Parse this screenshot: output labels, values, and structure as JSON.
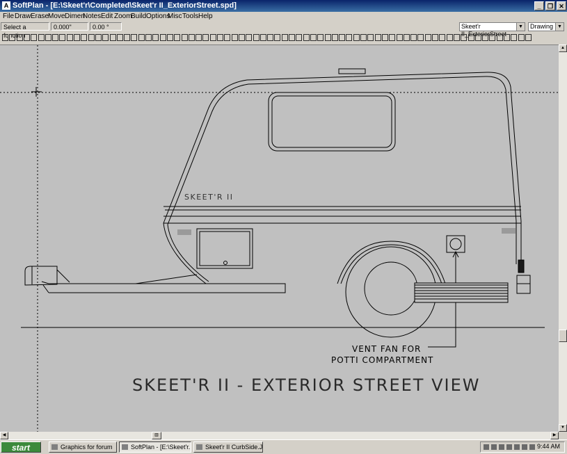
{
  "window": {
    "title": "SoftPlan - [E:\\Skeet'r\\Completed\\Skeet'r II_ExteriorStreet.spd]"
  },
  "menu": [
    "File",
    "Draw",
    "Erase",
    "Move",
    "Dimen",
    "Notes",
    "Edit",
    "Zoom",
    "Build",
    "Options",
    "Misc",
    "Tools",
    "Help"
  ],
  "status": {
    "prompt": "Select a function",
    "length": "0.000\"",
    "angle": "0.00 °"
  },
  "view_select": {
    "value": "Skeet'r II_ExteriorStreet"
  },
  "mode_select": {
    "value": "Drawing"
  },
  "drawing": {
    "brand_label": "SKEET'R II",
    "callout_line1": "VENT FAN FOR",
    "callout_line2": "POTTI COMPARTMENT",
    "caption": "SKEET'R II - EXTERIOR STREET VIEW"
  },
  "taskbar": {
    "start": "start",
    "tasks": [
      "Graphics for forum",
      "SoftPlan - [E:\\Skeet'r...",
      "Skeet'r II CurbSide.J..."
    ],
    "clock": "9:44 AM"
  }
}
